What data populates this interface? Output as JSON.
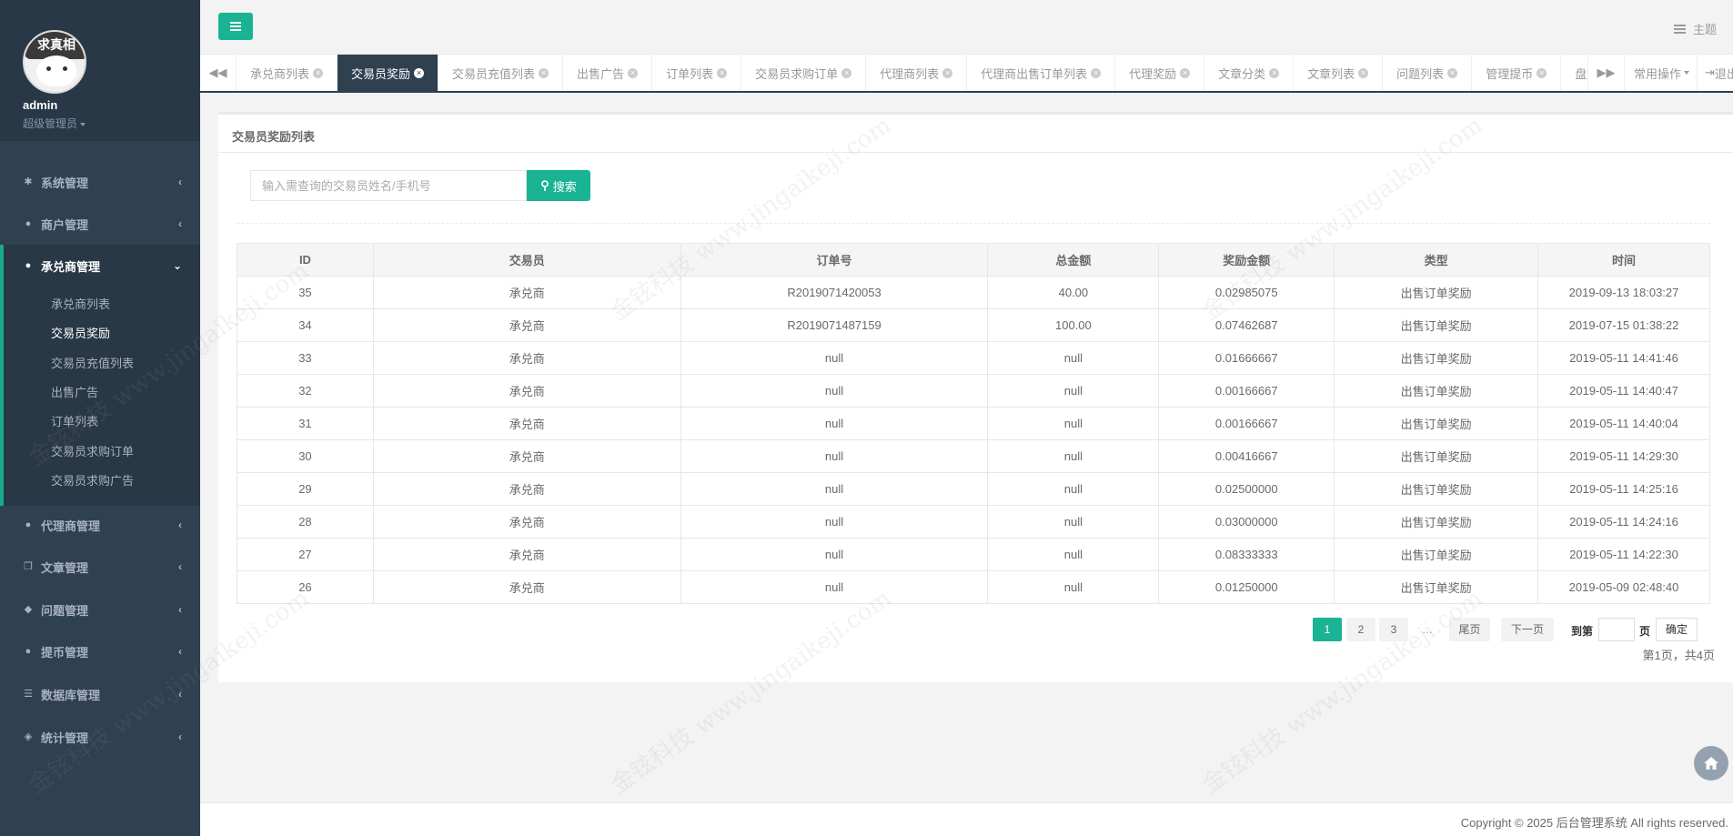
{
  "profile": {
    "avatar_text": "求真相",
    "username": "admin",
    "role": "超级管理员"
  },
  "sidebar": {
    "items": [
      {
        "label": "系统管理",
        "icon": "gear-icon"
      },
      {
        "label": "商户管理",
        "icon": "user-icon"
      },
      {
        "label": "承兑商管理",
        "icon": "user-icon"
      },
      {
        "label": "代理商管理",
        "icon": "user-icon"
      },
      {
        "label": "文章管理",
        "icon": "copy-icon"
      },
      {
        "label": "问题管理",
        "icon": "comment-icon"
      },
      {
        "label": "提币管理",
        "icon": "user-icon"
      },
      {
        "label": "数据库管理",
        "icon": "database-icon"
      },
      {
        "label": "统计管理",
        "icon": "cube-icon"
      }
    ],
    "submenu": [
      "承兑商列表",
      "交易员奖励",
      "交易员充值列表",
      "出售广告",
      "订单列表",
      "交易员求购订单",
      "交易员求购广告"
    ]
  },
  "topbar": {
    "theme_label": "主题"
  },
  "tabs": {
    "items": [
      "承兑商列表",
      "交易员奖励",
      "交易员充值列表",
      "出售广告",
      "订单列表",
      "交易员求购订单",
      "代理商列表",
      "代理商出售订单列表",
      "代理奖励",
      "文章分类",
      "文章列表",
      "问题列表",
      "管理提币",
      "盘"
    ],
    "ops_label": "常用操作",
    "logout_label": "退出"
  },
  "panel": {
    "title": "交易员奖励列表",
    "search_placeholder": "输入需查询的交易员姓名/手机号",
    "search_button": "搜索"
  },
  "table": {
    "headers": [
      "ID",
      "交易员",
      "订单号",
      "总金额",
      "奖励金额",
      "类型",
      "时间"
    ],
    "rows": [
      [
        "35",
        "承兑商",
        "R2019071420053",
        "40.00",
        "0.02985075",
        "出售订单奖励",
        "2019-09-13 18:03:27"
      ],
      [
        "34",
        "承兑商",
        "R2019071487159",
        "100.00",
        "0.07462687",
        "出售订单奖励",
        "2019-07-15 01:38:22"
      ],
      [
        "33",
        "承兑商",
        "null",
        "null",
        "0.01666667",
        "出售订单奖励",
        "2019-05-11 14:41:46"
      ],
      [
        "32",
        "承兑商",
        "null",
        "null",
        "0.00166667",
        "出售订单奖励",
        "2019-05-11 14:40:47"
      ],
      [
        "31",
        "承兑商",
        "null",
        "null",
        "0.00166667",
        "出售订单奖励",
        "2019-05-11 14:40:04"
      ],
      [
        "30",
        "承兑商",
        "null",
        "null",
        "0.00416667",
        "出售订单奖励",
        "2019-05-11 14:29:30"
      ],
      [
        "29",
        "承兑商",
        "null",
        "null",
        "0.02500000",
        "出售订单奖励",
        "2019-05-11 14:25:16"
      ],
      [
        "28",
        "承兑商",
        "null",
        "null",
        "0.03000000",
        "出售订单奖励",
        "2019-05-11 14:24:16"
      ],
      [
        "27",
        "承兑商",
        "null",
        "null",
        "0.08333333",
        "出售订单奖励",
        "2019-05-11 14:22:30"
      ],
      [
        "26",
        "承兑商",
        "null",
        "null",
        "0.01250000",
        "出售订单奖励",
        "2019-05-09 02:48:40"
      ]
    ]
  },
  "pagination": {
    "pages": [
      "1",
      "2",
      "3"
    ],
    "ellipsis": "…",
    "last": "尾页",
    "next": "下一页",
    "goto_prefix": "到第",
    "goto_suffix": "页",
    "confirm": "确定",
    "info": "第1页，共4页"
  },
  "footer": {
    "copyright": "Copyright © 2025 后台管理系统 All rights reserved."
  },
  "watermark": "金铉科技 www.jingaikeji.com",
  "colors": {
    "sidebar": "#2f4050",
    "accent": "#1ab394"
  }
}
